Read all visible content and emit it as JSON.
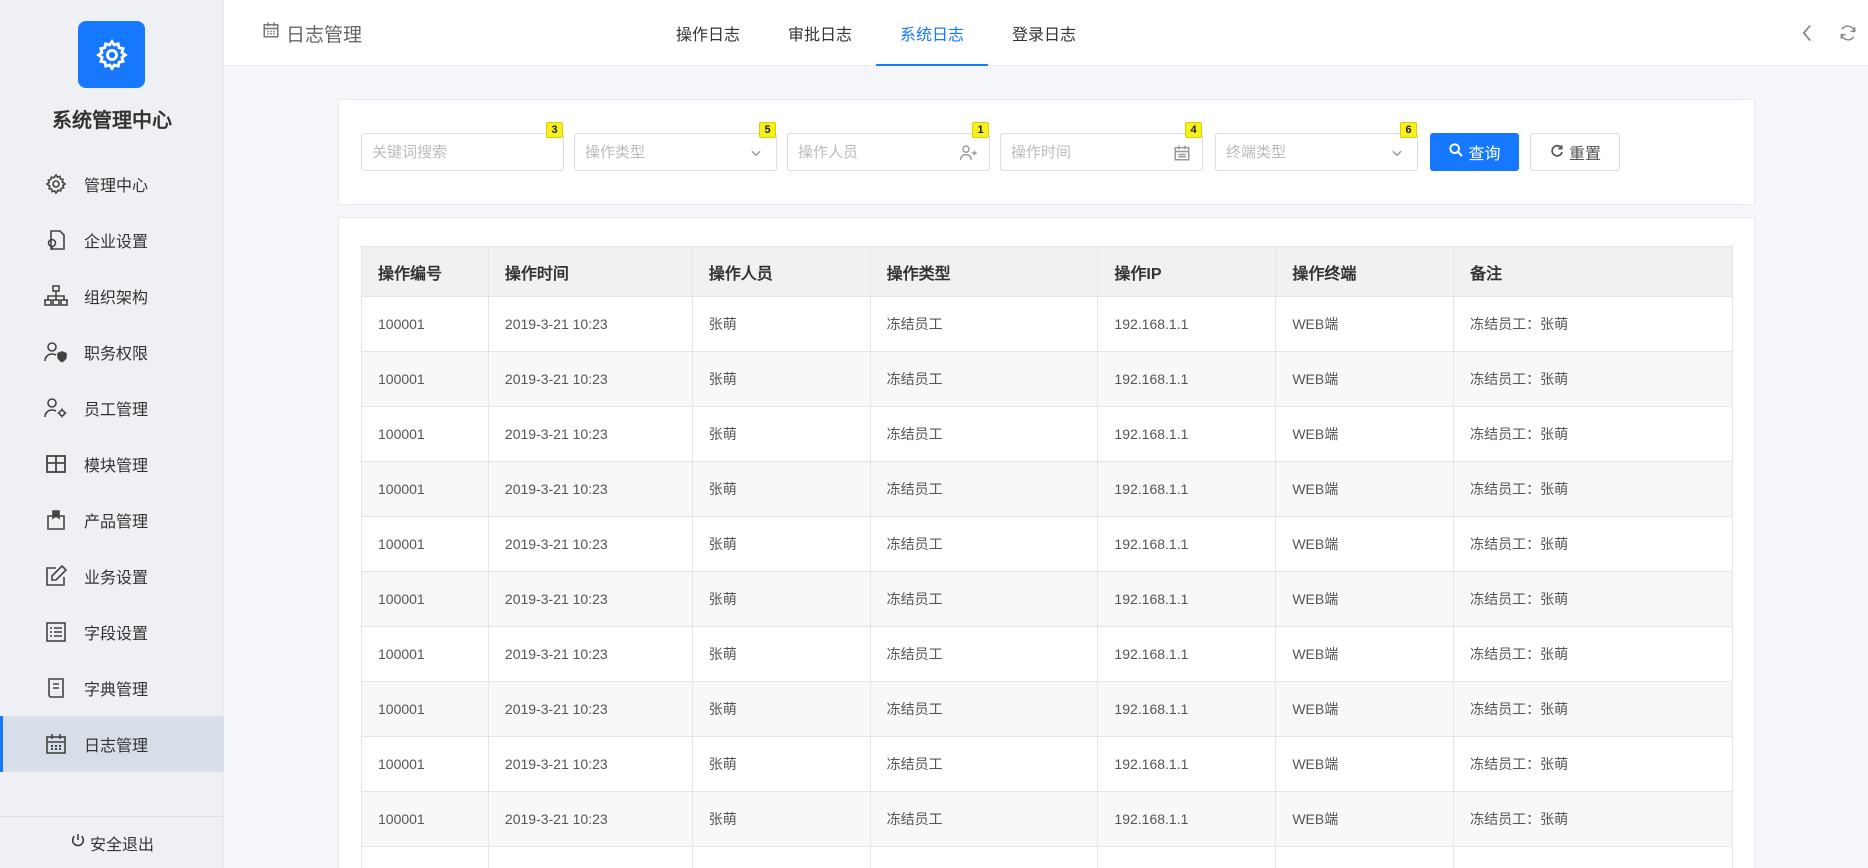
{
  "app": {
    "title": "系统管理中心",
    "logout_label": "安全退出"
  },
  "sidebar": {
    "items": [
      {
        "label": "管理中心",
        "icon": "gear-icon"
      },
      {
        "label": "企业设置",
        "icon": "enterprise-icon"
      },
      {
        "label": "组织架构",
        "icon": "org-chart-icon"
      },
      {
        "label": "职务权限",
        "icon": "user-shield-icon"
      },
      {
        "label": "员工管理",
        "icon": "user-gear-icon"
      },
      {
        "label": "模块管理",
        "icon": "grid-icon"
      },
      {
        "label": "产品管理",
        "icon": "box-icon"
      },
      {
        "label": "业务设置",
        "icon": "edit-icon"
      },
      {
        "label": "字段设置",
        "icon": "list-icon"
      },
      {
        "label": "字典管理",
        "icon": "book-icon"
      },
      {
        "label": "日志管理",
        "icon": "calendar-icon"
      }
    ],
    "active_index": 10
  },
  "header": {
    "page_title": "日志管理",
    "tabs": [
      {
        "label": "操作日志"
      },
      {
        "label": "审批日志"
      },
      {
        "label": "系统日志"
      },
      {
        "label": "登录日志"
      }
    ],
    "active_tab": 2
  },
  "filters": {
    "keyword": {
      "placeholder": "关键词搜索",
      "badge": "3"
    },
    "op_type": {
      "placeholder": "操作类型",
      "badge": "5"
    },
    "operator": {
      "placeholder": "操作人员",
      "badge": "1"
    },
    "op_time": {
      "placeholder": "操作时间",
      "badge": "4"
    },
    "terminal": {
      "placeholder": "终端类型",
      "badge": "6"
    },
    "search_label": "查询",
    "reset_label": "重置"
  },
  "table": {
    "columns": [
      "操作编号",
      "操作时间",
      "操作人员",
      "操作类型",
      "操作IP",
      "操作终端",
      "备注"
    ],
    "rows": [
      [
        "100001",
        "2019-3-21 10:23",
        "张萌",
        "冻结员工",
        "192.168.1.1",
        "WEB端",
        "冻结员工：张萌"
      ],
      [
        "100001",
        "2019-3-21 10:23",
        "张萌",
        "冻结员工",
        "192.168.1.1",
        "WEB端",
        "冻结员工：张萌"
      ],
      [
        "100001",
        "2019-3-21 10:23",
        "张萌",
        "冻结员工",
        "192.168.1.1",
        "WEB端",
        "冻结员工：张萌"
      ],
      [
        "100001",
        "2019-3-21 10:23",
        "张萌",
        "冻结员工",
        "192.168.1.1",
        "WEB端",
        "冻结员工：张萌"
      ],
      [
        "100001",
        "2019-3-21 10:23",
        "张萌",
        "冻结员工",
        "192.168.1.1",
        "WEB端",
        "冻结员工：张萌"
      ],
      [
        "100001",
        "2019-3-21 10:23",
        "张萌",
        "冻结员工",
        "192.168.1.1",
        "WEB端",
        "冻结员工：张萌"
      ],
      [
        "100001",
        "2019-3-21 10:23",
        "张萌",
        "冻结员工",
        "192.168.1.1",
        "WEB端",
        "冻结员工：张萌"
      ],
      [
        "100001",
        "2019-3-21 10:23",
        "张萌",
        "冻结员工",
        "192.168.1.1",
        "WEB端",
        "冻结员工：张萌"
      ],
      [
        "100001",
        "2019-3-21 10:23",
        "张萌",
        "冻结员工",
        "192.168.1.1",
        "WEB端",
        "冻结员工：张萌"
      ],
      [
        "100001",
        "2019-3-21 10:23",
        "张萌",
        "冻结员工",
        "192.168.1.1",
        "WEB端",
        "冻结员工：张萌"
      ],
      [
        "",
        "",
        "",
        "",
        "",
        "",
        ""
      ]
    ]
  },
  "colors": {
    "primary": "#1677ff",
    "sidebar_bg": "#eef0f4",
    "badge": "#f7f01c"
  }
}
